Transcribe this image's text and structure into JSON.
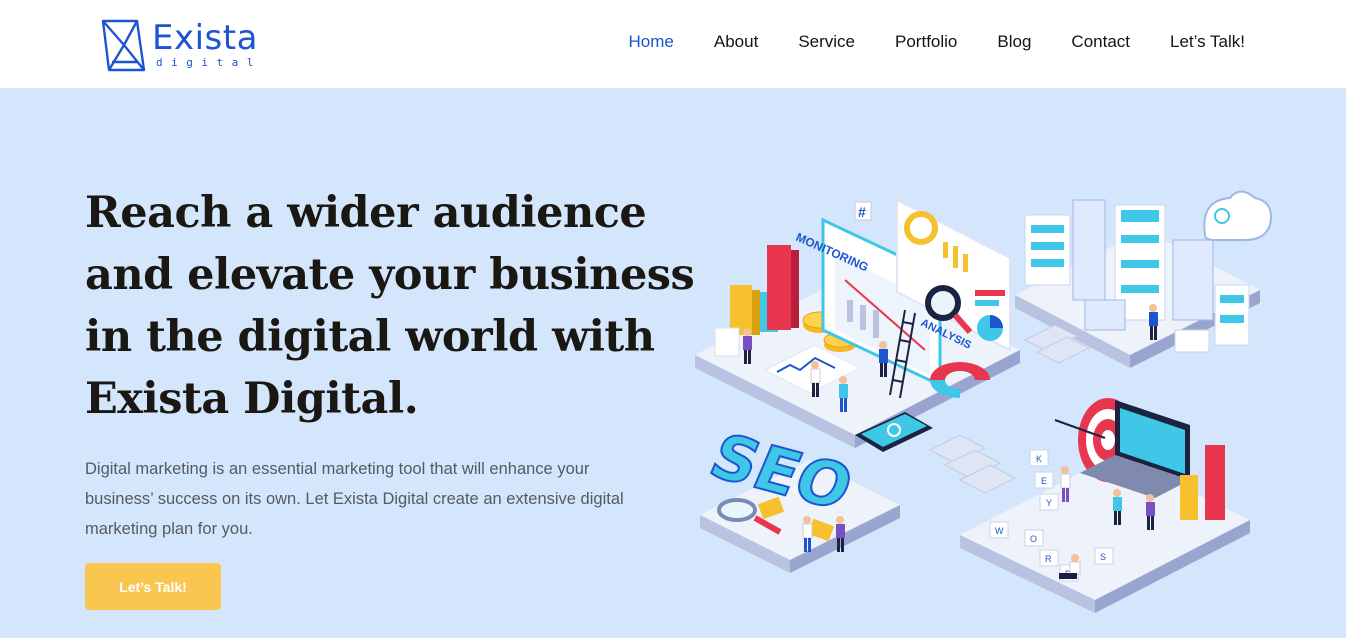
{
  "brand": {
    "name": "Exista",
    "sub": "digital",
    "color": "#1c55cf"
  },
  "nav": {
    "items": [
      {
        "label": "Home",
        "active": true
      },
      {
        "label": "About"
      },
      {
        "label": "Service"
      },
      {
        "label": "Portfolio"
      },
      {
        "label": "Blog"
      },
      {
        "label": "Contact"
      },
      {
        "label": "Let’s Talk!"
      }
    ]
  },
  "hero": {
    "title_lines": [
      "Reach a wider audience",
      "and elevate your business",
      "in the digital world with",
      "Exista Digital."
    ],
    "description": "Digital marketing is an essential marketing tool that will enhance your business’ success on its own. Let Exista Digital create an extensive digital marketing plan for you.",
    "cta_label": "Let’s Talk!"
  },
  "illustration": {
    "labels": {
      "monitoring": "MONITORING",
      "analysis": "ANALYSIS",
      "seo": "SEO",
      "hash": "#",
      "keywords_top": [
        "K",
        "E",
        "Y"
      ],
      "keywords_bottom": [
        "W",
        "O",
        "R",
        "D",
        "S"
      ]
    }
  },
  "colors": {
    "background": "#d4e6fb",
    "accent": "#f9c74f",
    "heading": "#1b1712",
    "nav_active": "#1c55cf"
  }
}
